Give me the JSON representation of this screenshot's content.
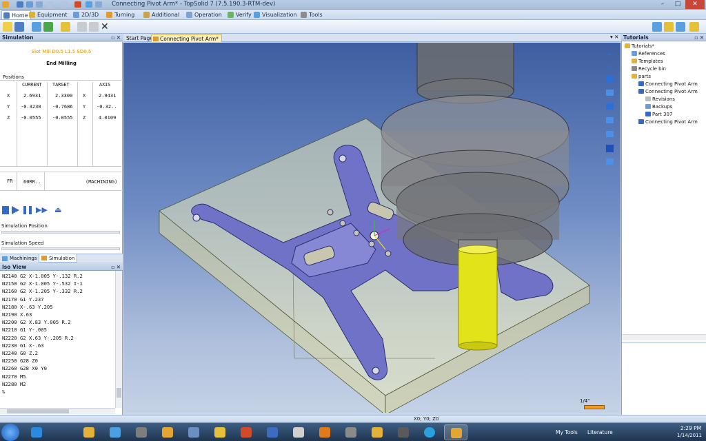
{
  "window": {
    "title": "Connecting Pivot Arm* - TopSolid 7 (7.5.190.3-RTM-dev)",
    "min_label": "–",
    "max_label": "□",
    "close_label": "✕"
  },
  "ribbon": {
    "tabs": [
      "Home",
      "Equipment",
      "2D/3D",
      "Turning",
      "Additional",
      "Operation",
      "Verify",
      "Visualization",
      "Tools"
    ]
  },
  "doc_tabs": [
    "Start Page",
    "Connecting Pivot Arm*"
  ],
  "simulation": {
    "header": "Simulation",
    "tool_name": "Slot Mill D0.5 L1.5 SD0.5",
    "operation": "End Milling",
    "positions_label": "Positions",
    "col_current": "CURRENT",
    "col_target": "TARGET",
    "col_axis": "AXIS",
    "rows": [
      {
        "axis": "X",
        "current": "2.6931",
        "target": "2.3300",
        "ax": "X",
        "axis_val": "2.9431"
      },
      {
        "axis": "Y",
        "current": "-0.3230",
        "target": "-0.7686",
        "ax": "Y",
        "axis_val": "-0.32.."
      },
      {
        "axis": "Z",
        "current": "-0.0555",
        "target": "-0.0555",
        "ax": "Z",
        "axis_val": "4.0109"
      }
    ],
    "fr_label": "FR",
    "fr_value": "60RR..",
    "fr_mode": "(MACHINING)",
    "sim_position_label": "Simulation Position",
    "sim_speed_label": "Simulation Speed",
    "bottom_tabs": [
      "Machinings",
      "Simulation"
    ]
  },
  "iso_view": {
    "header": "Iso View",
    "lines": [
      "N2140 G2 X-1.005 Y-.132 R.2",
      "N2150 G2 X-1.005 Y-.532 I-1",
      "N2160 G2 X-1.205 Y-.332 R.2",
      "N2170 G1 Y.237",
      "N2180 X-.63 Y.205",
      "N2190 X.63",
      "N2200 G2 X.83 Y.005 R.2",
      "N2210 G1 Y-.005",
      "N2220 G2 X.63 Y-.205 R.2",
      "N2230 G1 X-.63",
      "N2240 G0 Z.2",
      "N2250 G28 Z0",
      "N2260 G28 X0 Y0",
      "N2270 M5",
      "N2280 M2",
      "%"
    ]
  },
  "viewport": {
    "scale_label": "1/4\""
  },
  "tutorials": {
    "header": "Tutorials",
    "items": [
      {
        "label": "Tutorials*",
        "indent": 0
      },
      {
        "label": "References",
        "indent": 1
      },
      {
        "label": "Templates",
        "indent": 1
      },
      {
        "label": "Recycle bin",
        "indent": 1
      },
      {
        "label": "parts",
        "indent": 1
      },
      {
        "label": "Connecting Pivot Arm",
        "indent": 2
      },
      {
        "label": "Connecting Pivot Arm",
        "indent": 2
      },
      {
        "label": "Revisions",
        "indent": 3
      },
      {
        "label": "Backups",
        "indent": 3
      },
      {
        "label": "Part 307",
        "indent": 3
      },
      {
        "label": "Connecting Pivot Arm",
        "indent": 2
      }
    ]
  },
  "status": {
    "coords": "X0; Y0; Z0"
  },
  "taskbar": {
    "my_tools": "My Tools",
    "literature": "Literature",
    "time": "2:29 PM",
    "date": "1/14/2011"
  },
  "colors": {
    "accent_orange": "#e08a00",
    "part_purple": "#6d6fc0",
    "tool_yellow": "#e3e31a",
    "stock_fill": "#e6e6b0"
  }
}
